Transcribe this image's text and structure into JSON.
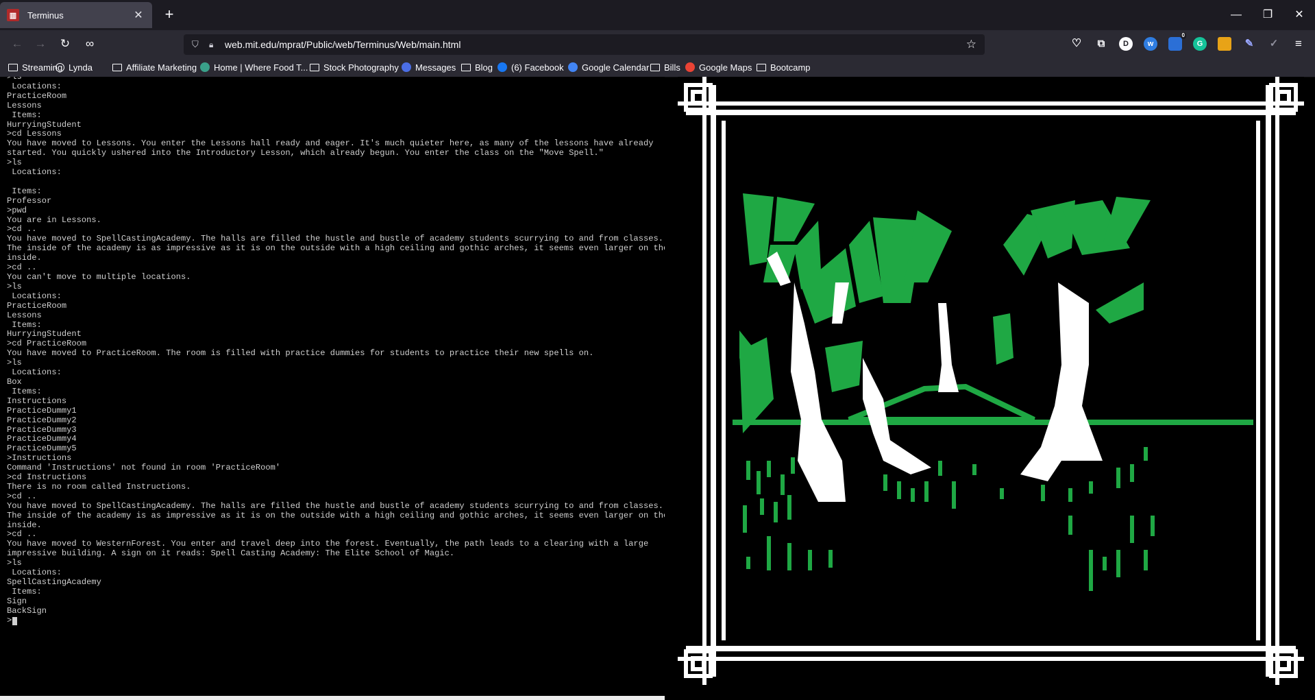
{
  "browser": {
    "tab_title": "Terminus",
    "url": "web.mit.edu/mprat/Public/web/Terminus/Web/main.html",
    "ext_badge_count": "0",
    "ext_profile_letter": "D",
    "bookmarks": [
      {
        "label": "Streaming",
        "icon": "folder-icon"
      },
      {
        "label": "Lynda",
        "icon": "globe-icon"
      },
      {
        "label": "Affiliate Marketing",
        "icon": "folder-icon"
      },
      {
        "label": "Home | Where Food T...",
        "icon": "site-icon"
      },
      {
        "label": "Stock Photography",
        "icon": "folder-icon"
      },
      {
        "label": "Messages",
        "icon": "messages-icon"
      },
      {
        "label": "Blog",
        "icon": "folder-icon"
      },
      {
        "label": "(6) Facebook",
        "icon": "facebook-icon"
      },
      {
        "label": "Google Calendar",
        "icon": "calendar-icon"
      },
      {
        "label": "Bills",
        "icon": "folder-icon"
      },
      {
        "label": "Google Maps",
        "icon": "google-icon"
      },
      {
        "label": "Bootcamp",
        "icon": "folder-icon"
      }
    ]
  },
  "terminal": {
    "prompt": ">",
    "lines": [
      ">ls",
      " Locations:",
      "PracticeRoom",
      "Lessons",
      " Items:",
      "HurryingStudent",
      ">cd Lessons",
      "You have moved to Lessons. You enter the Lessons hall ready and eager. It's much quieter here, as many of the lessons have already",
      "started. You quickly ushered into the Introductory Lesson, which already begun. You enter the class on the \"Move Spell.\"",
      ">ls",
      " Locations:",
      "",
      " Items:",
      "Professor",
      ">pwd",
      "You are in Lessons.",
      ">cd ..",
      "You have moved to SpellCastingAcademy. The halls are filled the hustle and bustle of academy students scurrying to and from classes.",
      "The inside of the academy is as impressive as it is on the outside with a high ceiling and gothic arches, it seems even larger on the",
      "inside.",
      ">cd ..",
      "You can't move to multiple locations.",
      ">ls",
      " Locations:",
      "PracticeRoom",
      "Lessons",
      " Items:",
      "HurryingStudent",
      ">cd PracticeRoom",
      "You have moved to PracticeRoom. The room is filled with practice dummies for students to practice their new spells on.",
      ">ls",
      " Locations:",
      "Box",
      " Items:",
      "Instructions",
      "PracticeDummy1",
      "PracticeDummy2",
      "PracticeDummy3",
      "PracticeDummy4",
      "PracticeDummy5",
      ">Instructions",
      "Command 'Instructions' not found in room 'PracticeRoom'",
      ">cd Instructions",
      "There is no room called Instructions.",
      ">cd ..",
      "You have moved to SpellCastingAcademy. The halls are filled the hustle and bustle of academy students scurrying to and from classes.",
      "The inside of the academy is as impressive as it is on the outside with a high ceiling and gothic arches, it seems even larger on the",
      "inside.",
      ">cd ..",
      "You have moved to WesternForest. You enter and travel deep into the forest. Eventually, the path leads to a clearing with a large",
      "impressive building. A sign on it reads: Spell Casting Academy: The Elite School of Magic.",
      ">ls",
      " Locations:",
      "SpellCastingAcademy",
      " Items:",
      "Sign",
      "BackSign"
    ]
  },
  "colors": {
    "tabbar_bg": "#1c1b22",
    "toolbar_bg": "#2b2a33",
    "terminal_text": "#cfcfcf",
    "art_green": "#1fa844",
    "art_black": "#000000",
    "art_white": "#ffffff"
  }
}
